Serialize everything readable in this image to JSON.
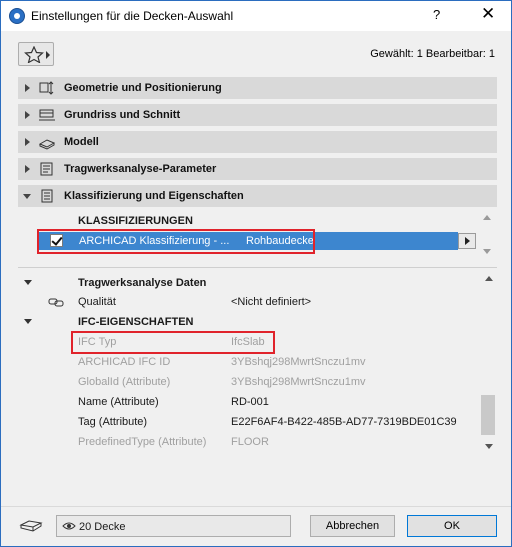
{
  "window": {
    "title": "Einstellungen für die Decken-Auswahl",
    "help_label": "?",
    "close_label": "✕"
  },
  "toolbar": {
    "selection_info": "Gewählt: 1 Bearbeitbar: 1"
  },
  "sections": [
    {
      "label": "Geometrie und Positionierung",
      "icon": "geometry-icon",
      "expanded": false
    },
    {
      "label": "Grundriss und Schnitt",
      "icon": "floorplan-icon",
      "expanded": false
    },
    {
      "label": "Modell",
      "icon": "model-icon",
      "expanded": false
    },
    {
      "label": "Tragwerksanalyse-Parameter",
      "icon": "structural-icon",
      "expanded": false
    },
    {
      "label": "Klassifizierung und Eigenschaften",
      "icon": "classification-icon",
      "expanded": true
    }
  ],
  "classification": {
    "header": "KLASSIFIZIERUNGEN",
    "row_label": "ARCHICAD Klassifizierung - ...",
    "row_value": "Rohbaudecke",
    "checked": true
  },
  "properties": {
    "group1": "Tragwerksanalyse Daten",
    "qualitaet_name": "Qualität",
    "qualitaet_value": "<Nicht definiert>",
    "group2": "IFC-EIGENSCHAFTEN",
    "rows": [
      {
        "name": "IFC Typ",
        "value": "IfcSlab",
        "greyed": true
      },
      {
        "name": "ARCHICAD IFC ID",
        "value": "3YBshqj298MwrtSnczu1mv",
        "greyed": true
      },
      {
        "name": "GlobalId (Attribute)",
        "value": "3YBshqj298MwrtSnczu1mv",
        "greyed": true
      },
      {
        "name": "Name (Attribute)",
        "value": "RD-001",
        "greyed": false
      },
      {
        "name": "Tag (Attribute)",
        "value": "E22F6AF4-B422-485B-AD77-7319BDE01C39",
        "greyed": false
      },
      {
        "name": "PredefinedType (Attribute)",
        "value": "FLOOR",
        "greyed": true
      }
    ]
  },
  "footer": {
    "view_label": "20 Decke",
    "cancel_label": "Abbrechen",
    "ok_label": "OK"
  },
  "colors": {
    "selection": "#3d86cf",
    "highlight_box": "#e0232b",
    "section_bg": "#d9d9d9"
  }
}
